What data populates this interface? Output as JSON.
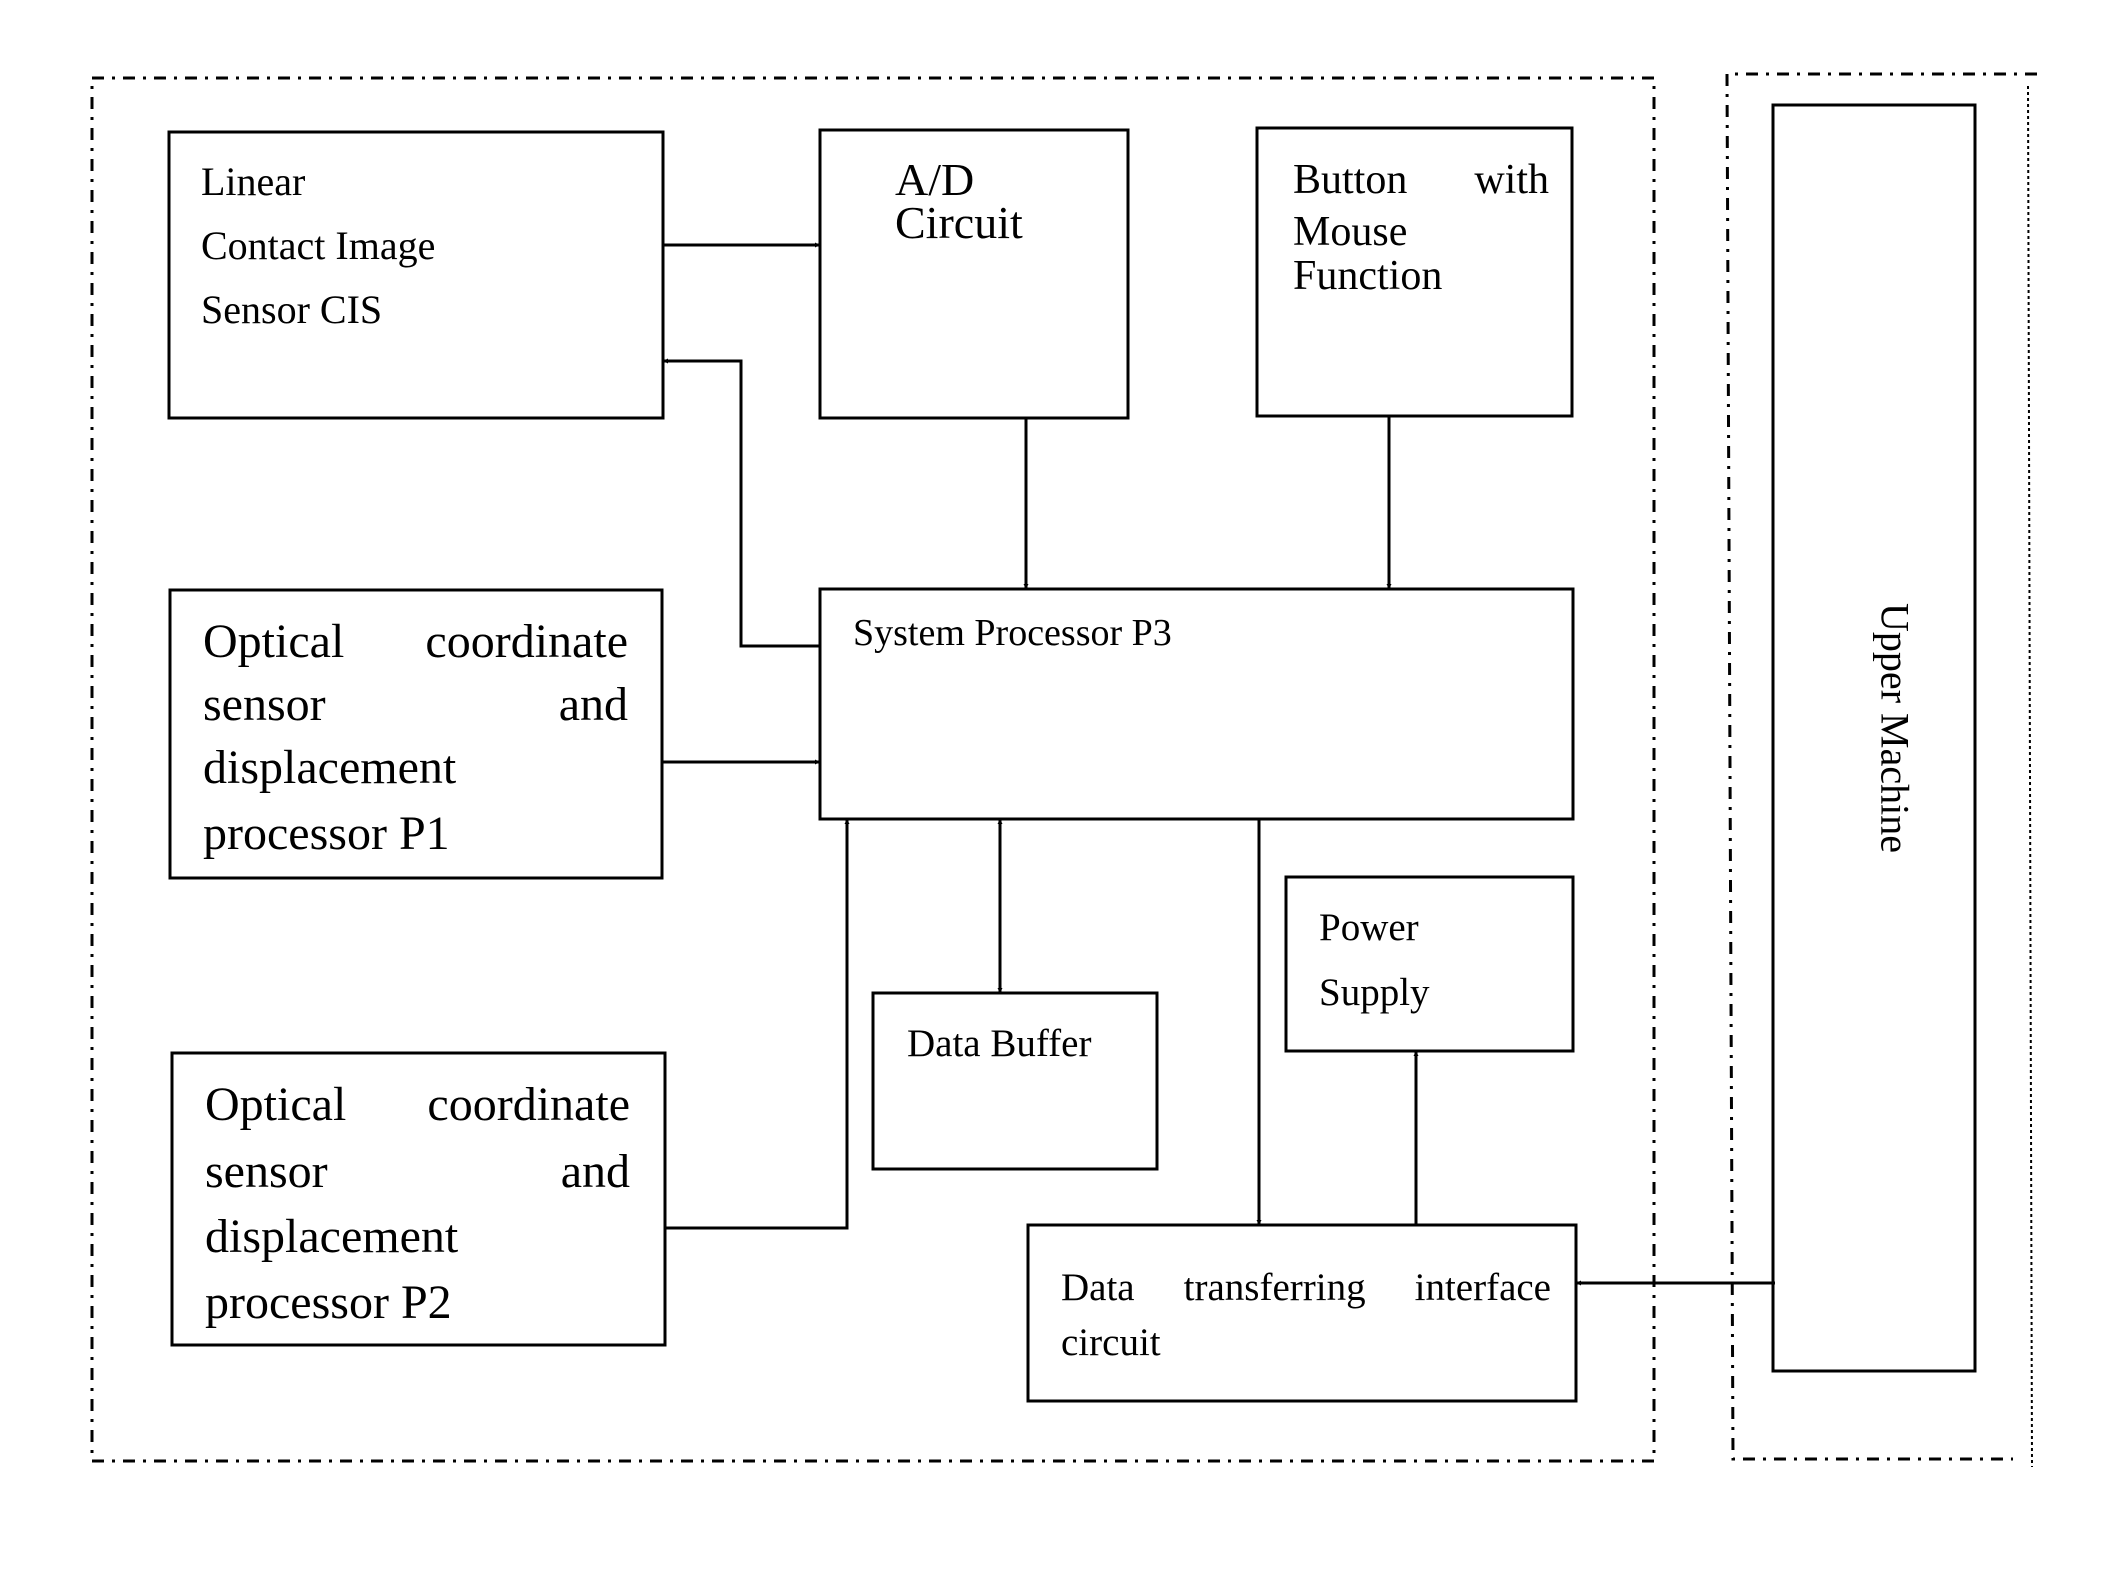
{
  "diagram": {
    "regions": [
      {
        "id": "device",
        "label": ""
      },
      {
        "id": "host",
        "label": ""
      }
    ],
    "blocks": {
      "cis": {
        "lines": [
          "Linear",
          "Contact Image",
          "Sensor CIS"
        ]
      },
      "adc": {
        "lines": [
          "A/D",
          "Circuit"
        ]
      },
      "button": {
        "lines": [
          [
            "Button",
            "with"
          ],
          "Mouse",
          "Function"
        ]
      },
      "p3": {
        "lines": [
          "System Processor P3"
        ]
      },
      "p1": {
        "lines": [
          [
            "Optical",
            "coordinate"
          ],
          [
            "sensor",
            "and"
          ],
          "displacement",
          "processor P1"
        ]
      },
      "p2": {
        "lines": [
          [
            "Optical",
            "coordinate"
          ],
          [
            "sensor",
            "and"
          ],
          "displacement",
          "processor P2"
        ]
      },
      "buffer": {
        "lines": [
          "Data Buffer"
        ]
      },
      "power": {
        "lines": [
          "Power",
          "Supply"
        ]
      },
      "dti": {
        "lines": [
          [
            "Data",
            "transferring",
            "interface"
          ],
          "circuit"
        ]
      },
      "upper": {
        "lines": [
          "Upper Machine"
        ]
      }
    },
    "text": {
      "cis_1": "Linear",
      "cis_2": "Contact Image",
      "cis_3": "Sensor CIS",
      "adc_1": "A/D",
      "adc_2": "Circuit",
      "button_1a": "Button",
      "button_1b": "with",
      "button_2": "Mouse",
      "button_3": "Function",
      "p3_1": "System Processor P3",
      "p1_1a": "Optical",
      "p1_1b": "coordinate",
      "p1_2a": "sensor",
      "p1_2b": "and",
      "p1_3": "displacement",
      "p1_4": "processor P1",
      "p2_1a": "Optical",
      "p2_1b": "coordinate",
      "p2_2a": "sensor",
      "p2_2b": "and",
      "p2_3": "displacement",
      "p2_4": "processor P2",
      "buffer_1": "Data Buffer",
      "power_1": "Power",
      "power_2": "Supply",
      "dti_1a": "Data",
      "dti_1b": "transferring",
      "dti_1c": "interface",
      "dti_2": "circuit",
      "upper_1": "Upper Machine"
    },
    "connections": [
      {
        "from": "Linear Contact Image Sensor CIS",
        "to": "A/D Circuit",
        "direction": "forward"
      },
      {
        "from": "System Processor P3",
        "to": "Linear Contact Image Sensor CIS",
        "direction": "forward"
      },
      {
        "from": "A/D Circuit",
        "to": "System Processor P3",
        "direction": "forward"
      },
      {
        "from": "Button with Mouse Function",
        "to": "System Processor P3",
        "direction": "forward"
      },
      {
        "from": "Optical coordinate sensor and displacement processor P1",
        "to": "System Processor P3",
        "direction": "forward"
      },
      {
        "from": "Optical coordinate sensor and displacement processor P2",
        "to": "System Processor P3",
        "direction": "forward"
      },
      {
        "from": "System Processor P3",
        "to": "Data Buffer",
        "direction": "bidirectional"
      },
      {
        "from": "System Processor P3",
        "to": "Data transferring interface circuit",
        "direction": "forward"
      },
      {
        "from": "Data transferring interface circuit",
        "to": "Power Supply",
        "direction": "forward"
      },
      {
        "from": "Upper Machine",
        "to": "Data transferring interface circuit",
        "direction": "forward"
      }
    ],
    "colors": {
      "ink": "#000000",
      "paper": "#ffffff"
    }
  }
}
